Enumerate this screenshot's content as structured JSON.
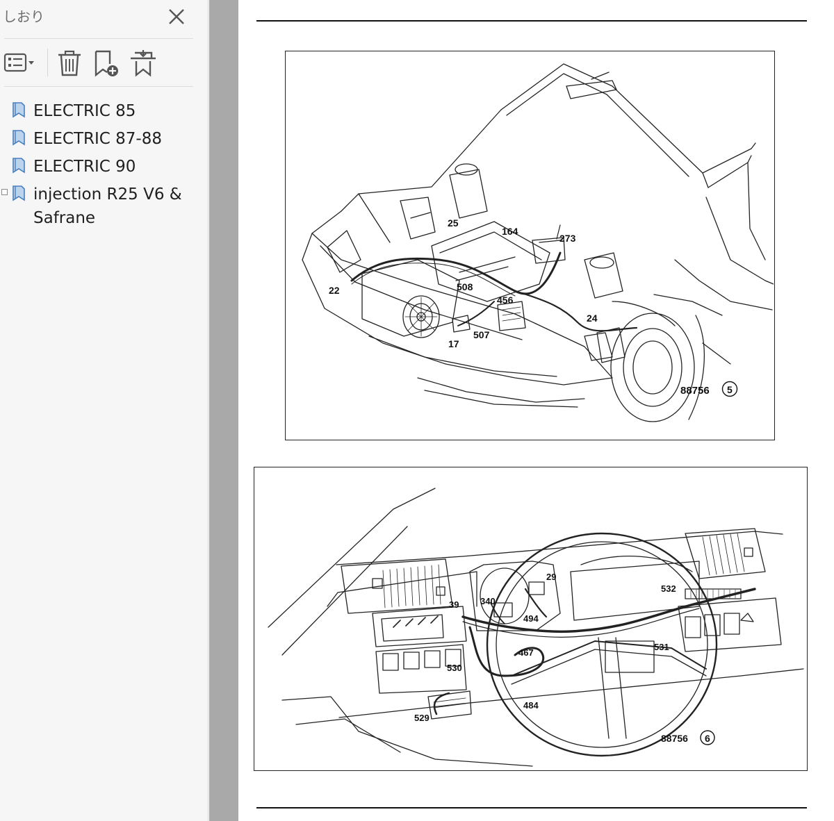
{
  "sidebar": {
    "title": "しおり",
    "close_icon": "close-icon",
    "toolbar": [
      {
        "name": "options-menu-button",
        "icon": "list-options-icon"
      },
      {
        "name": "delete-bookmark-button",
        "icon": "trash-icon"
      },
      {
        "name": "new-bookmark-button",
        "icon": "bookmark-add-icon"
      },
      {
        "name": "find-bookmark-button",
        "icon": "bookmark-find-icon"
      }
    ],
    "bookmarks": [
      {
        "label": "ELECTRIC 85"
      },
      {
        "label": "ELECTRIC 87-88"
      },
      {
        "label": "ELECTRIC 90"
      },
      {
        "label": "injection R25 V6 &",
        "label2": "Safrane",
        "expandable": true
      }
    ]
  },
  "document": {
    "figure1": {
      "ref": "88756",
      "number": "5",
      "callouts": [
        "25",
        "164",
        "273",
        "508",
        "456",
        "22",
        "24",
        "507",
        "17"
      ]
    },
    "figure2": {
      "ref": "88756",
      "number": "6",
      "callouts": [
        "29",
        "340",
        "39",
        "532",
        "494",
        "467",
        "531",
        "530",
        "529",
        "484"
      ]
    }
  },
  "colors": {
    "sidebar_bg": "#f6f6f6",
    "viewer_bg": "#a9a9a9",
    "bookmark_icon": "#4a7fbf"
  }
}
